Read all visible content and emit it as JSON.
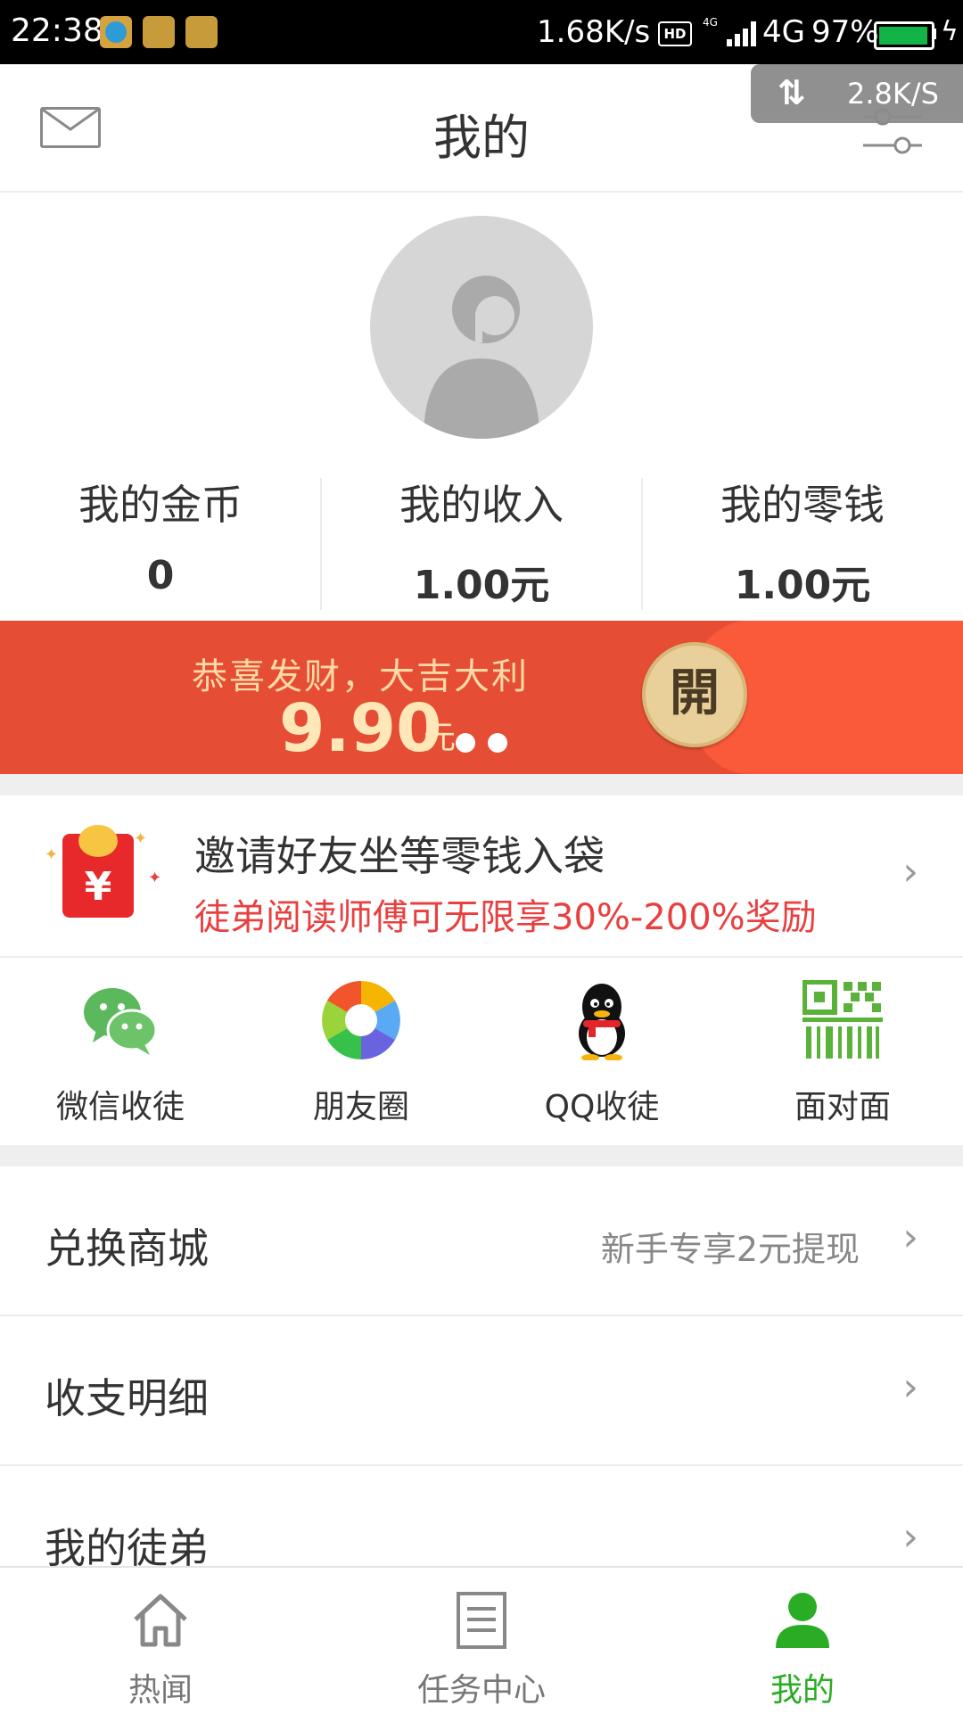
{
  "status_bar": {
    "time": "22:38",
    "net_speed": "1.68K/s",
    "hd": "HD",
    "signal_small": "4G",
    "network": "4G",
    "battery": "97%"
  },
  "speed_overlay": {
    "arrows": "⇅",
    "text": "2.8K/S"
  },
  "header": {
    "title": "我的",
    "mail_icon": "mail-icon",
    "settings_icon": "settings-icon"
  },
  "stats": [
    {
      "label": "我的金币",
      "value": "0"
    },
    {
      "label": "我的收入",
      "value": "1.00元"
    },
    {
      "label": "我的零钱",
      "value": "1.00元"
    }
  ],
  "banner": {
    "text": "恭喜发财，大吉大利",
    "amount": "9.90",
    "unit": "元",
    "open_label": "開",
    "page_index": 1,
    "page_count": 2
  },
  "invite": {
    "title": "邀请好友坐等零钱入袋",
    "subtitle": "徒弟阅读师傅可无限享30%-200%奖励",
    "icon": "red-packet-icon"
  },
  "share": [
    {
      "label": "微信收徒",
      "icon": "wechat-icon"
    },
    {
      "label": "朋友圈",
      "icon": "moments-icon"
    },
    {
      "label": "QQ收徒",
      "icon": "qq-icon"
    },
    {
      "label": "面对面",
      "icon": "qr-code-icon"
    }
  ],
  "menu": [
    {
      "label": "兑换商城",
      "extra": "新手专享2元提现"
    },
    {
      "label": "收支明细",
      "extra": ""
    },
    {
      "label": "我的徒弟",
      "extra": ""
    }
  ],
  "nav": [
    {
      "label": "热闻",
      "icon": "home-icon",
      "active": false
    },
    {
      "label": "任务中心",
      "icon": "task-list-icon",
      "active": false
    },
    {
      "label": "我的",
      "icon": "profile-icon",
      "active": true
    }
  ],
  "colors": {
    "accent_green": "#2aad24",
    "banner_red": "#e54e34",
    "subtitle_red": "#e84040"
  }
}
